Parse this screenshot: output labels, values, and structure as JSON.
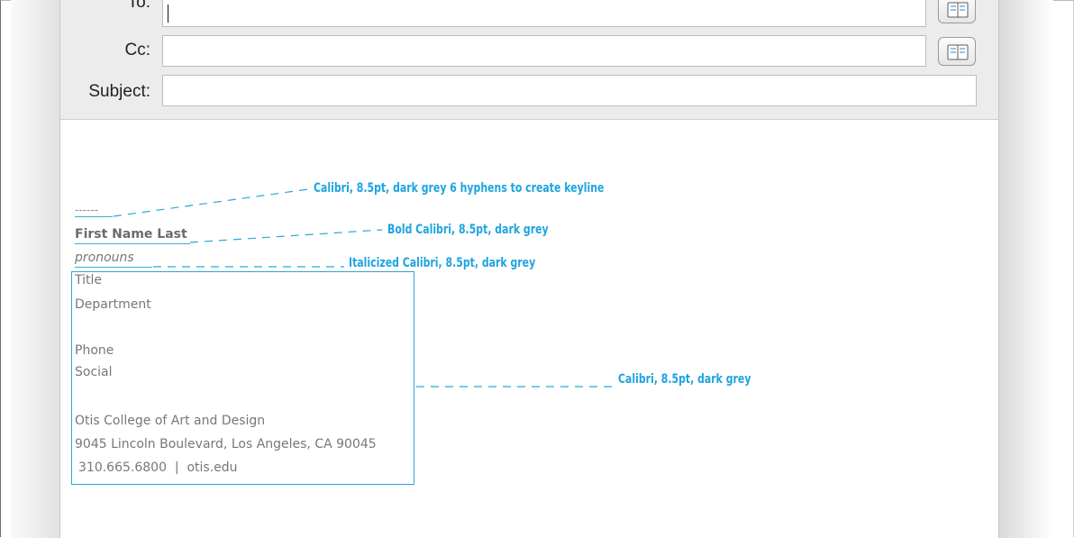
{
  "header": {
    "to_label": "To:",
    "cc_label": "Cc:",
    "subject_label": "Subject:",
    "to_value": "",
    "cc_value": "",
    "subject_value": ""
  },
  "signature": {
    "keyline": "------",
    "name": "First Name Last",
    "pronouns": "pronouns",
    "title": "Title",
    "department": "Department",
    "phone": "Phone",
    "social": "Social",
    "college": "Otis College of Art and Design",
    "address": "9045 Lincoln Boulevard, Los Angeles, CA 90045",
    "contact": "310.665.6800  |  otis.edu"
  },
  "annotations": {
    "keyline_note": "Calibri, 8.5pt, dark grey 6 hyphens to create keyline",
    "name_note": "Bold Calibri, 8.5pt, dark grey",
    "pronouns_note": "Italicized Calibri, 8.5pt, dark grey",
    "block_note": "Calibri, 8.5pt, dark grey"
  },
  "colors": {
    "annotation": "#1ea4e0",
    "signature_text": "#777777",
    "header_bg": "#ececec"
  }
}
